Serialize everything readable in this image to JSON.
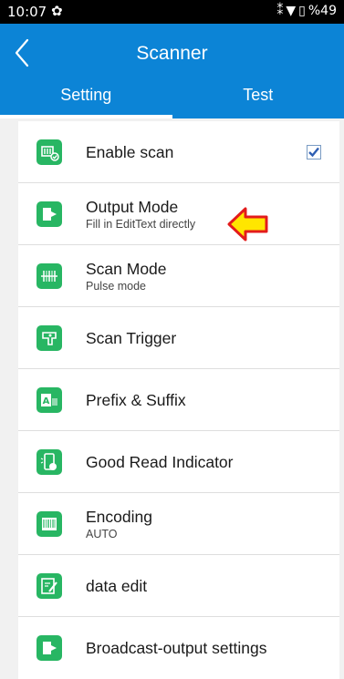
{
  "status_bar": {
    "time": "10:07",
    "battery": "%49",
    "icons": [
      "settings-icon",
      "vibrate-icon",
      "wifi-icon",
      "battery-icon"
    ]
  },
  "toolbar": {
    "title": "Scanner"
  },
  "tabs": [
    {
      "label": "Setting",
      "active": true
    },
    {
      "label": "Test",
      "active": false
    }
  ],
  "colors": {
    "primary": "#0c84d6",
    "icon_green": "#28b663",
    "background": "#f1f1f1"
  },
  "settings": [
    {
      "title": "Enable scan",
      "subtitle": "",
      "icon": "enable-scan-icon",
      "checked": true
    },
    {
      "title": "Output Mode",
      "subtitle": "Fill in EditText directly",
      "icon": "output-mode-icon"
    },
    {
      "title": "Scan Mode",
      "subtitle": "Pulse mode",
      "icon": "scan-mode-icon"
    },
    {
      "title": "Scan Trigger",
      "subtitle": "",
      "icon": "scan-trigger-icon"
    },
    {
      "title": "Prefix & Suffix",
      "subtitle": "",
      "icon": "prefix-suffix-icon"
    },
    {
      "title": "Good Read Indicator",
      "subtitle": "",
      "icon": "good-read-indicator-icon"
    },
    {
      "title": "Encoding",
      "subtitle": "AUTO",
      "icon": "barcode-icon"
    },
    {
      "title": "data edit",
      "subtitle": "",
      "icon": "data-edit-icon"
    },
    {
      "title": "Broadcast-output settings",
      "subtitle": "",
      "icon": "broadcast-output-icon"
    }
  ]
}
